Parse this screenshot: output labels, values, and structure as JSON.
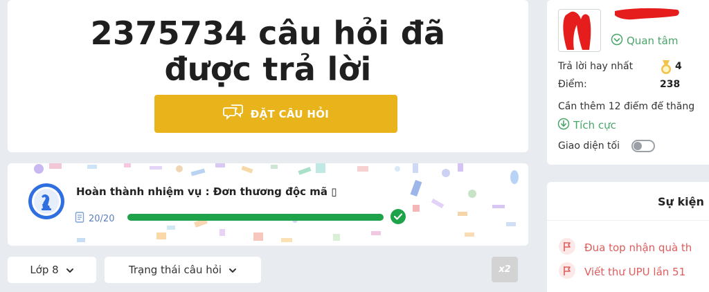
{
  "hero": {
    "headline_line1": "2375734 câu hỏi đã",
    "headline_line2": "được trả lời",
    "ask_button_label": "ĐẶT CÂU HỎI",
    "ask_button_color": "#e8b31b"
  },
  "mission": {
    "title": "Hoàn thành nhiệm vụ : Đơn thương độc mã ▯",
    "progress_text": "20/20",
    "progress_fraction": 1.0,
    "medal_number": "2",
    "progress_color": "#1fa34a"
  },
  "filters": {
    "grade_label": "Lớp 8",
    "status_label": "Trạng thái câu hỏi",
    "x2_label": "x2"
  },
  "profile": {
    "follow_label": "Quan tâm",
    "best_answers_label": "Trả lời hay nhất",
    "best_answers_value": "4",
    "points_label": "Điểm:",
    "points_value": "238",
    "need_more_text": "Cần thêm 12 điểm để thăng",
    "status_label": "Tích cực",
    "dark_mode_label": "Giao diện tối",
    "dark_mode_on": false
  },
  "events": {
    "header": "Sự kiện",
    "items": [
      {
        "label": "Đua top nhận quà th",
        "icon": "flag-icon"
      },
      {
        "label": "Viết thư UPU lần 51",
        "icon": "flag-icon"
      }
    ]
  }
}
